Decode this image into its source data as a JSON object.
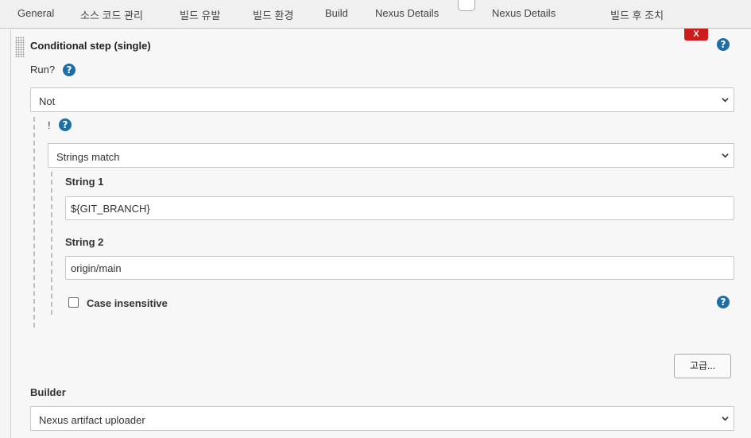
{
  "tabs": [
    "General",
    "소스 코드 관리",
    "빌드 유발",
    "빌드 환경",
    "Build",
    "Nexus Details",
    "Nexus Details",
    "빌드 후 조치"
  ],
  "step": {
    "title": "Conditional step (single)",
    "delete_label": "X",
    "run_label": "Run?",
    "run_value": "Not",
    "not_label": "!",
    "condition_value": "Strings match",
    "string1_label": "String 1",
    "string1_value": "${GIT_BRANCH}",
    "string2_label": "String 2",
    "string2_value": "origin/main",
    "case_insensitive_label": "Case insensitive",
    "case_insensitive_checked": false,
    "advanced_label": "고급...",
    "builder_label": "Builder",
    "builder_value": "Nexus artifact uploader"
  },
  "help_glyph": "?",
  "colors": {
    "help": "#1c6ea4",
    "delete": "#cc1d1d"
  },
  "icons": {
    "help": "help-icon",
    "chevron": "chevron-down-icon",
    "drag": "drag-handle-icon"
  }
}
